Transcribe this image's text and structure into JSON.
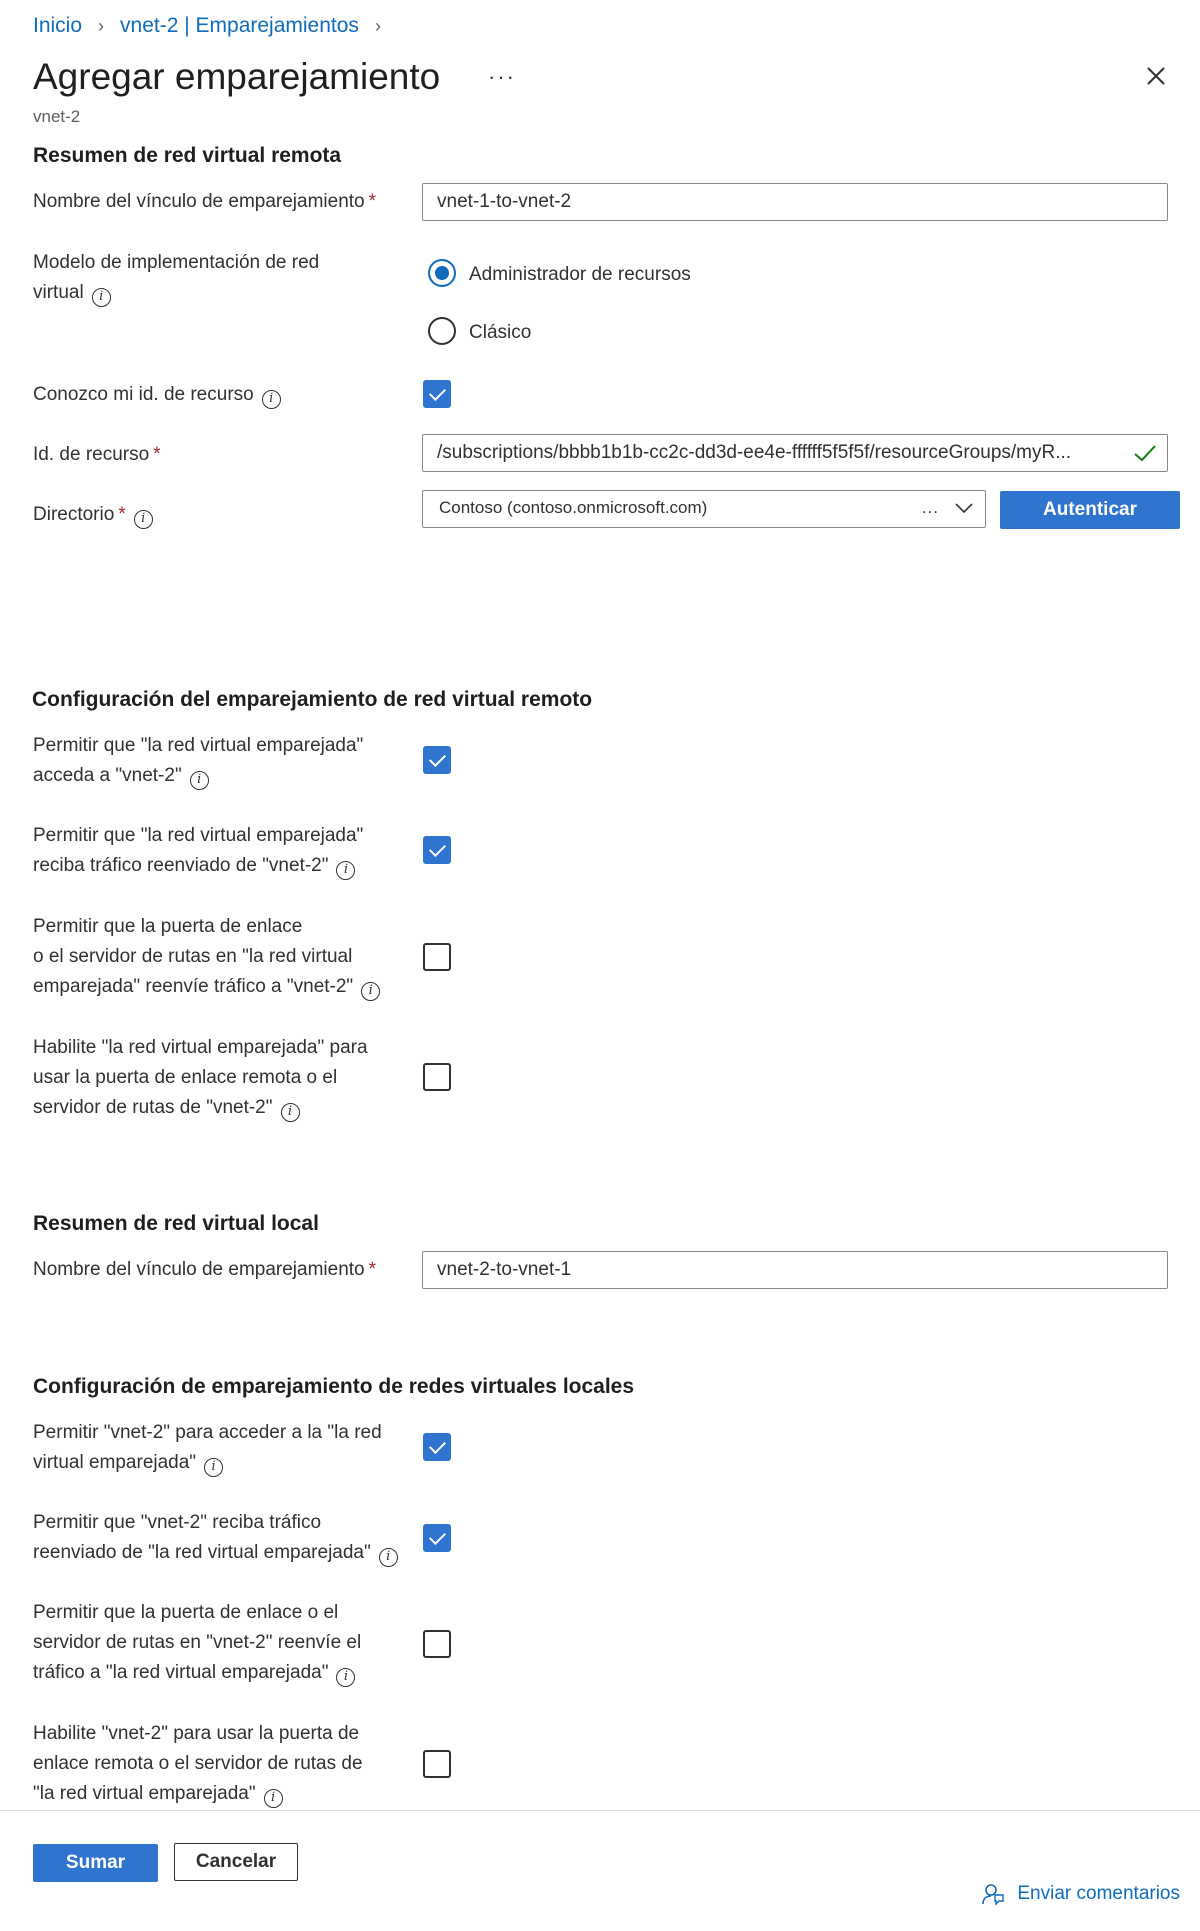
{
  "breadcrumb": {
    "items": [
      "Inicio",
      "vnet-2 | Emparejamientos"
    ]
  },
  "header": {
    "title": "Agregar emparejamiento",
    "more": "···",
    "subtitle": "vnet-2"
  },
  "remote_summary": {
    "title": "Resumen de red virtual remota",
    "link_name_label": "Nombre del vínculo de emparejamiento",
    "link_name_value": "vnet-1-to-vnet-2",
    "deploy_model_label_line1": "Modelo de implementación de red",
    "deploy_model_label_line2": "virtual",
    "deploy_options": [
      "Administrador de recursos",
      "Clásico"
    ],
    "deploy_selected": "Administrador de recursos",
    "know_id_label": "Conozco mi id. de recurso",
    "know_id_checked": true,
    "resource_id_label": "Id. de recurso",
    "resource_id_value": "/subscriptions/bbbb1b1b-cc2c-dd3d-ee4e-ffffff5f5f5f/resourceGroups/myR...",
    "directory_label": "Directorio",
    "directory_value": "Contoso (contoso.onmicrosoft.com)",
    "directory_ellipsis": "...",
    "authenticate_button": "Autenticar"
  },
  "remote_config": {
    "title": "Configuración del emparejamiento de red virtual remoto",
    "options": [
      {
        "lines": [
          "Permitir que \"la red virtual emparejada\"",
          "acceda a \"vnet-2\""
        ],
        "checked": true
      },
      {
        "lines": [
          "Permitir que \"la red virtual emparejada\"",
          "reciba tráfico reenviado de \"vnet-2\""
        ],
        "checked": true
      },
      {
        "lines": [
          "Permitir que la puerta de enlace",
          "o el servidor de rutas en \"la red virtual",
          "emparejada\" reenvíe tráfico a \"vnet-2\""
        ],
        "checked": false
      },
      {
        "lines": [
          "Habilite \"la red virtual emparejada\" para",
          "usar la puerta de enlace remota o el",
          "servidor de rutas de \"vnet-2\""
        ],
        "checked": false
      }
    ]
  },
  "local_summary": {
    "title": "Resumen de red virtual local",
    "link_name_label": "Nombre del vínculo de emparejamiento",
    "link_name_value": "vnet-2-to-vnet-1"
  },
  "local_config": {
    "title": "Configuración de emparejamiento de redes virtuales locales",
    "options": [
      {
        "lines": [
          "Permitir \"vnet-2\" para acceder a la \"la red",
          "virtual emparejada\""
        ],
        "checked": true
      },
      {
        "lines": [
          "Permitir que \"vnet-2\" reciba tráfico",
          "reenviado de \"la red virtual emparejada\""
        ],
        "checked": true
      },
      {
        "lines": [
          "Permitir que la puerta de enlace o el",
          "servidor de rutas en \"vnet-2\" reenvíe el",
          "tráfico a \"la red virtual emparejada\""
        ],
        "checked": false
      },
      {
        "lines": [
          "Habilite \"vnet-2\" para usar la puerta de",
          "enlace remota o el servidor de rutas de",
          "\"la red virtual emparejada\""
        ],
        "checked": false
      }
    ]
  },
  "footer": {
    "submit_button": "Sumar",
    "cancel_button": "Cancelar",
    "feedback_link": "Enviar comentarios"
  },
  "icons": {
    "info": "info-icon",
    "close": "close-icon",
    "chevron": "chevron-down-icon",
    "valid": "checkmark-icon",
    "feedback": "feedback-icon"
  },
  "colors": {
    "accent": "#2f74cf",
    "link": "#0f6cbd",
    "required": "#a4262c",
    "valid": "#107c10"
  }
}
